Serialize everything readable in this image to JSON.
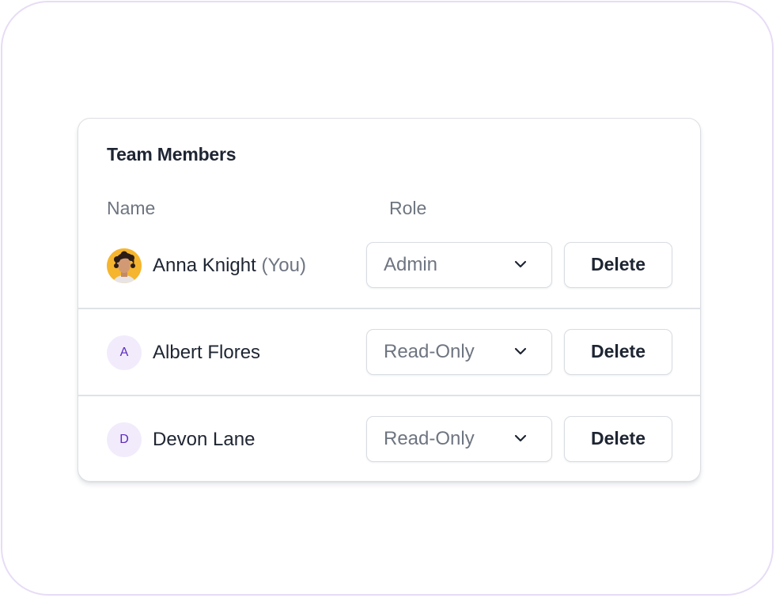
{
  "panel": {
    "title": "Team Members",
    "columns": {
      "name": "Name",
      "role": "Role"
    }
  },
  "members": [
    {
      "name": "Anna Knight",
      "you_tag": "(You)",
      "avatar": "photo",
      "role": "Admin",
      "delete_label": "Delete"
    },
    {
      "name": "Albert Flores",
      "avatar_initial": "A",
      "role": "Read-Only",
      "delete_label": "Delete"
    },
    {
      "name": "Devon Lane",
      "avatar_initial": "D",
      "role": "Read-Only",
      "delete_label": "Delete"
    }
  ],
  "icons": {
    "dropdown": "chevron-down-icon"
  },
  "colors": {
    "frame_border": "#e7dcf6",
    "text_primary": "#1e2532",
    "text_secondary": "#6e7580",
    "initial_avatar_bg": "#f1ebfc",
    "initial_avatar_text": "#5b2bbd",
    "photo_avatar_bg": "#f5b52e"
  }
}
